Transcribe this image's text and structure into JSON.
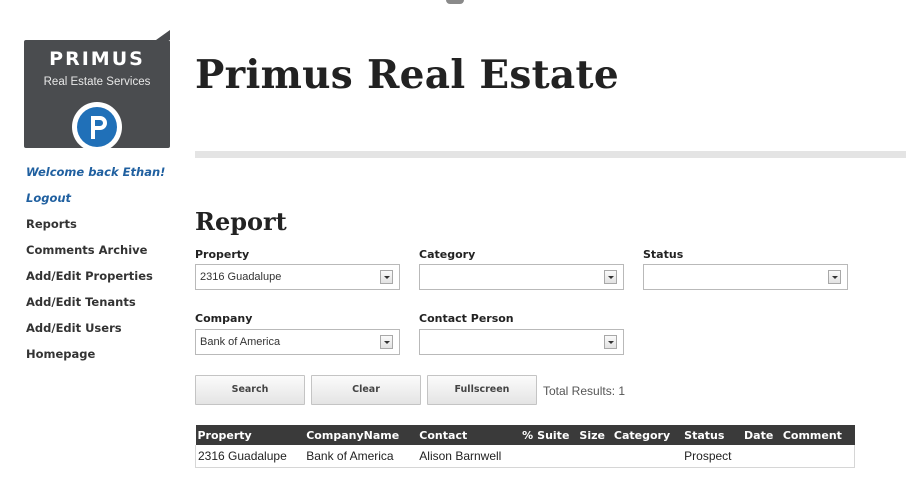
{
  "logo": {
    "title": "PRIMUS",
    "subtitle": "Real Estate Services",
    "mark_letter": "P",
    "panel_color": "#4a4c4f",
    "mark_color": "#2070b8"
  },
  "sidebar": {
    "welcome": "Welcome back Ethan!",
    "items": [
      {
        "label": "Logout"
      },
      {
        "label": "Reports"
      },
      {
        "label": "Comments Archive"
      },
      {
        "label": "Add/Edit Properties"
      },
      {
        "label": "Add/Edit Tenants"
      },
      {
        "label": "Add/Edit Users"
      },
      {
        "label": "Homepage"
      }
    ]
  },
  "header": {
    "title": "Primus Real Estate"
  },
  "report": {
    "title": "Report",
    "filters": {
      "property": {
        "label": "Property",
        "value": "2316 Guadalupe"
      },
      "category": {
        "label": "Category",
        "value": ""
      },
      "status": {
        "label": "Status",
        "value": ""
      },
      "company": {
        "label": "Company",
        "value": "Bank of America"
      },
      "contact_person": {
        "label": "Contact Person",
        "value": ""
      }
    },
    "buttons": {
      "search": "Search",
      "clear": "Clear",
      "fullscreen": "Fullscreen"
    },
    "total_results": "Total Results: 1",
    "table": {
      "columns": [
        "Property",
        "CompanyName",
        "Contact",
        "%",
        "Suite",
        "Size",
        "Category",
        "Status",
        "Date",
        "Comment"
      ],
      "rows": [
        [
          "2316 Guadalupe",
          "Bank of America",
          "Alison Barnwell",
          "",
          "",
          "",
          "",
          "Prospect",
          "",
          ""
        ]
      ]
    }
  }
}
